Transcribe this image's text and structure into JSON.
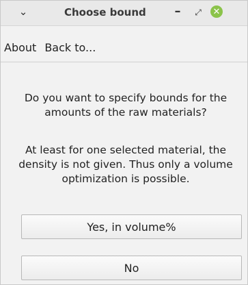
{
  "window": {
    "title": "Choose bound",
    "menu_glyph": "⌄",
    "min_glyph": "–",
    "max_glyph": "⤢",
    "close_glyph": "✕"
  },
  "menu": {
    "items": [
      {
        "label": "About"
      },
      {
        "label": "Back to..."
      }
    ]
  },
  "dialog": {
    "message1": "Do you want to specify bounds for the amounts of the raw materials?",
    "message2": "At least for one selected material, the density is not given. Thus only a volume optimization is possible.",
    "yes_label": "Yes, in volume%",
    "no_label": "No"
  },
  "colors": {
    "close_button": "#8bc34a",
    "background": "#f2f2f2"
  }
}
